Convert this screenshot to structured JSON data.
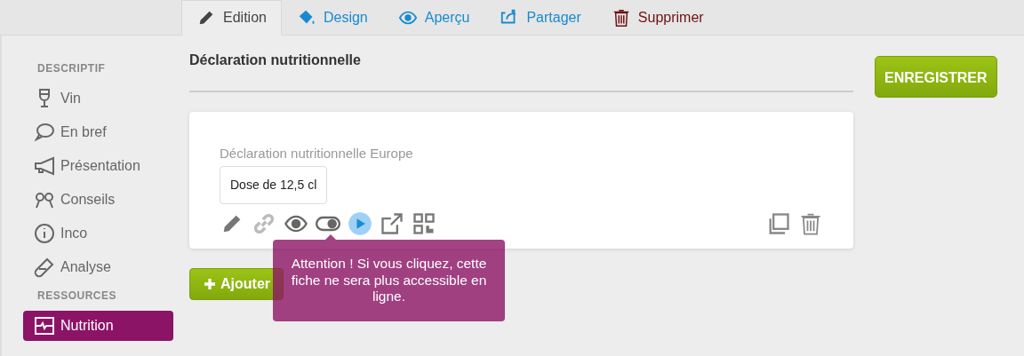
{
  "tabs": [
    {
      "label": "Edition",
      "kind": "neutral",
      "selected": true
    },
    {
      "label": "Design",
      "kind": "link",
      "selected": false
    },
    {
      "label": "Aperçu",
      "kind": "link",
      "selected": false
    },
    {
      "label": "Partager",
      "kind": "link",
      "selected": false
    },
    {
      "label": "Supprimer",
      "kind": "danger",
      "selected": false
    }
  ],
  "sidebar": {
    "sections": [
      {
        "title": "DESCRIPTIF",
        "items": [
          {
            "label": "Vin",
            "selected": false
          },
          {
            "label": "En bref",
            "selected": false
          },
          {
            "label": "Présentation",
            "selected": false
          },
          {
            "label": "Conseils",
            "selected": false
          },
          {
            "label": "Inco",
            "selected": false
          },
          {
            "label": "Analyse",
            "selected": false
          }
        ]
      },
      {
        "title": "RESSOURCES",
        "items": [
          {
            "label": "Nutrition",
            "selected": true
          }
        ]
      }
    ]
  },
  "section_title": "Déclaration nutritionnelle",
  "card": {
    "label": "Déclaration nutritionnelle Europe",
    "value": "Dose de 12,5 cl"
  },
  "tooltip": "Attention ! Si vous cliquez, cette fiche ne sera plus accessible en ligne.",
  "add_button": "Ajouter",
  "save_button": "ENREGISTRER"
}
